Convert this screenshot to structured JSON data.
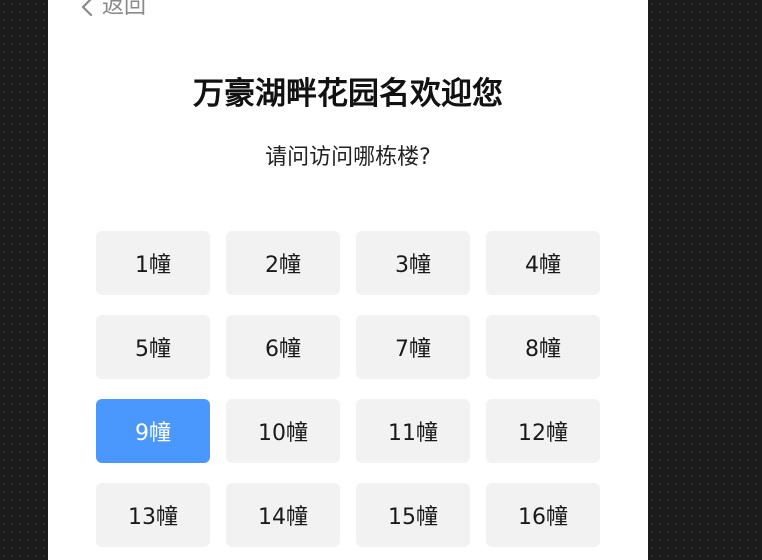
{
  "header": {
    "back_label": "返回",
    "back_icon": "chevron-left-icon"
  },
  "welcome": {
    "title": "万豪湖畔花园名欢迎您",
    "question": "请问访问哪栋楼?"
  },
  "colors": {
    "accent": "#4a97fd",
    "button_bg": "#f2f2f2",
    "backdrop": "#1b1b1b"
  },
  "buildings": {
    "selected_index": 8,
    "items": [
      {
        "label": "1幢"
      },
      {
        "label": "2幢"
      },
      {
        "label": "3幢"
      },
      {
        "label": "4幢"
      },
      {
        "label": "5幢"
      },
      {
        "label": "6幢"
      },
      {
        "label": "7幢"
      },
      {
        "label": "8幢"
      },
      {
        "label": "9幢"
      },
      {
        "label": "10幢"
      },
      {
        "label": "11幢"
      },
      {
        "label": "12幢"
      },
      {
        "label": "13幢"
      },
      {
        "label": "14幢"
      },
      {
        "label": "15幢"
      },
      {
        "label": "16幢"
      }
    ]
  }
}
